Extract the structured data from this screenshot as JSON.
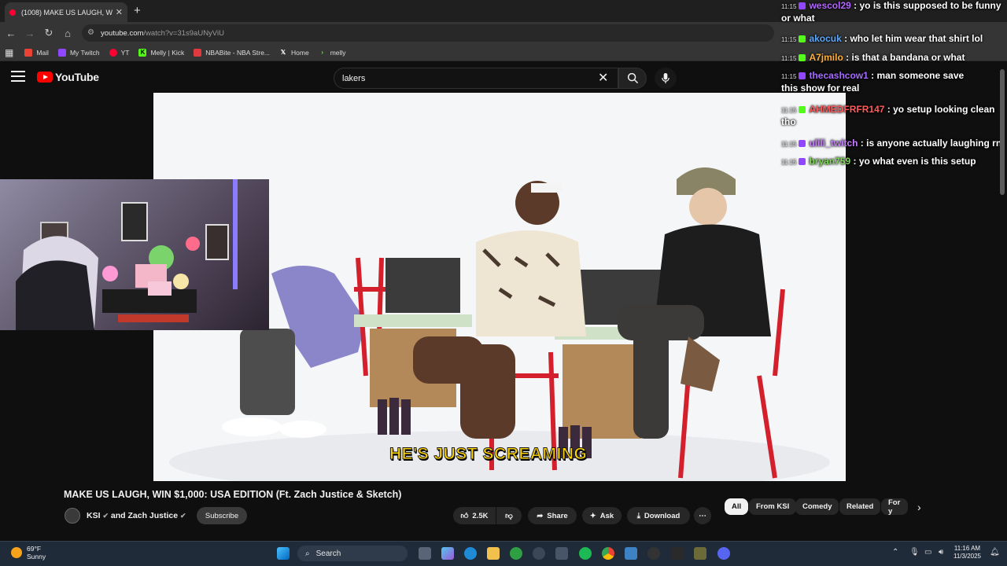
{
  "browser": {
    "tab_title": "(1008) MAKE US LAUGH, W",
    "url_host": "youtube.com",
    "url_path": "/watch?v=31s9aUNyViU",
    "bookmarks": [
      {
        "label": "Mail",
        "icon": "gmail-icon",
        "color": "#ea4335"
      },
      {
        "label": "My Twitch",
        "icon": "twitch-icon",
        "color": "#9146ff"
      },
      {
        "label": "YT",
        "icon": "youtube-icon",
        "color": "#ff0033"
      },
      {
        "label": "Melly | Kick",
        "icon": "kick-icon",
        "color": "#53fc18"
      },
      {
        "label": "NBABite - NBA Stre...",
        "icon": "nba-icon",
        "color": "#e03a3e"
      },
      {
        "label": "Home",
        "icon": "x-icon",
        "color": "#ffffff"
      },
      {
        "label": "melly",
        "icon": "kick-icon",
        "color": "#53fc18"
      }
    ]
  },
  "youtube": {
    "logo_text": "YouTube",
    "search_value": "lakers",
    "video": {
      "caption": "HE'S JUST SCREAMING",
      "title": "MAKE US LAUGH, WIN $1,000: USA EDITION (Ft. Zach Justice & Sketch)",
      "channel": "KSI",
      "channel_joiner": "and Zach Justice",
      "subscribe_label": "Subscribe",
      "likes": "2.5K",
      "share_label": "Share",
      "ask_label": "Ask",
      "download_label": "Download"
    },
    "chips": [
      "All",
      "From KSI",
      "Comedy",
      "Related",
      "For y"
    ]
  },
  "chat": [
    {
      "time": "11:15",
      "badge": "twitch",
      "user": "wescol29",
      "user_color": "#b266ff",
      "message": ": yo is this supposed to be funny",
      "wrap": "or what"
    },
    {
      "time": "11:15",
      "badge": "kick",
      "user": "akocuk",
      "user_color": "#5aa9ff",
      "message": ": who let him wear that shirt lol",
      "wrap": ""
    },
    {
      "time": "11:15",
      "badge": "kick",
      "user": "A7jmilo",
      "user_color": "#ffb13b",
      "message": ": is that a bandana or what",
      "wrap": ""
    },
    {
      "time": "11:15",
      "badge": "twitch",
      "user": "thecashcow1",
      "user_color": "#a66bff",
      "message": ": man someone save",
      "wrap": "this show for real"
    },
    {
      "time": "11:15",
      "badge": "kick",
      "user": "AHMEDFRFR147",
      "user_color": "#ff5a5a",
      "message": ": yo setup looking clean",
      "wrap": "tho"
    },
    {
      "time": "11:15",
      "badge": "twitch",
      "user": "ulili_twitch",
      "user_color": "#c77dff",
      "message": ": is anyone actually laughing rn",
      "wrap": ""
    },
    {
      "time": "11:15",
      "badge": "twitch",
      "user": "bryan759",
      "user_color": "#7ed957",
      "message": ": yo what even is this setup",
      "wrap": ""
    }
  ],
  "taskbar": {
    "temperature": "69°F",
    "condition": "Sunny",
    "search_label": "Search",
    "time": "11:16 AM",
    "date": "11/3/2025"
  }
}
